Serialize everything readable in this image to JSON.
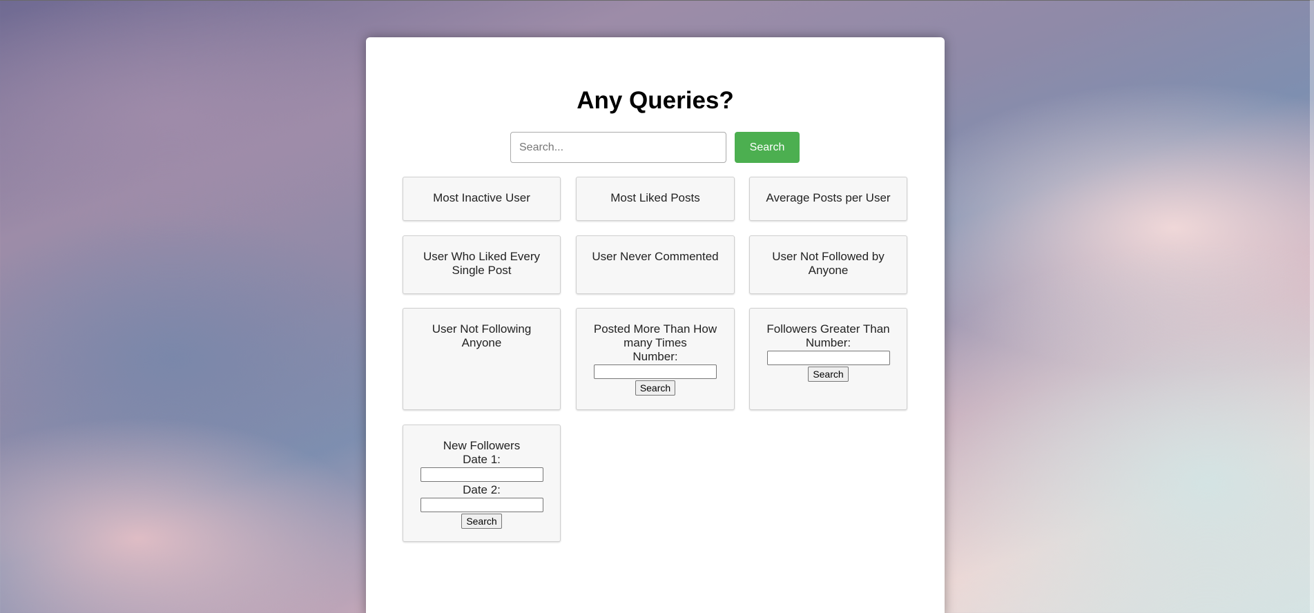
{
  "page": {
    "title": "Any Queries?",
    "search": {
      "placeholder": "Search...",
      "button_label": "Search",
      "button_color": "#4caf50"
    }
  },
  "cards": {
    "most_inactive_user": "Most Inactive User",
    "most_liked_posts": "Most Liked Posts",
    "average_posts_per_user": "Average Posts per User",
    "user_liked_every_post": "User Who Liked Every Single Post",
    "user_never_commented": "User Never Commented",
    "user_not_followed": "User Not Followed by Anyone",
    "user_not_following": "User Not Following Anyone",
    "posted_more_than": {
      "label": "Posted More Than How many Times",
      "field_label": "Number:",
      "button_label": "Search"
    },
    "followers_greater_than": {
      "label": "Followers Greater Than",
      "field_label": "Number:",
      "button_label": "Search"
    },
    "new_followers": {
      "label": "New Followers",
      "date1_label": "Date 1:",
      "date2_label": "Date 2:",
      "button_label": "Search"
    }
  }
}
